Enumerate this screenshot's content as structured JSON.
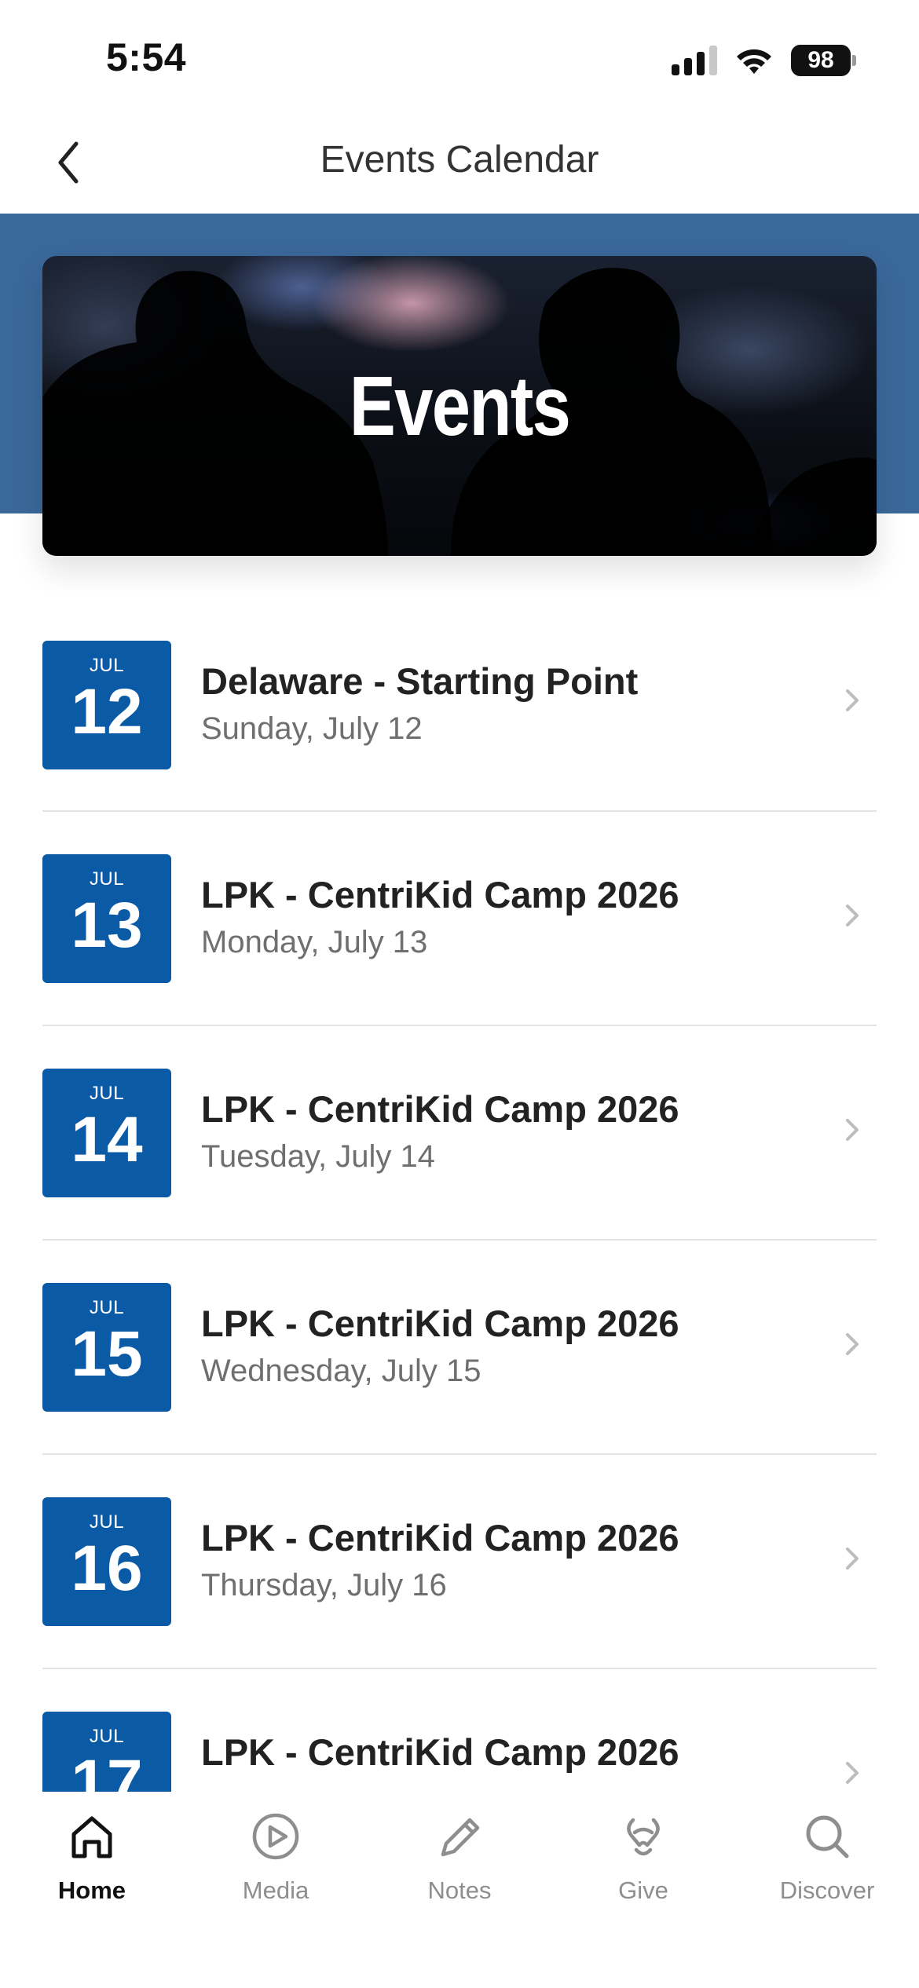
{
  "status_bar": {
    "time": "5:54",
    "battery": "98",
    "icons": [
      "cellular-signal-icon",
      "wifi-icon",
      "battery-icon"
    ]
  },
  "header": {
    "title": "Events Calendar",
    "back_icon": "chevron-left-icon"
  },
  "banner": {
    "title": "Events"
  },
  "events": [
    {
      "month": "JUL",
      "day": "12",
      "title": "Delaware - Starting Point",
      "date": "Sunday, July 12"
    },
    {
      "month": "JUL",
      "day": "13",
      "title": "LPK - CentriKid Camp 2026",
      "date": "Monday, July 13"
    },
    {
      "month": "JUL",
      "day": "14",
      "title": "LPK - CentriKid Camp 2026",
      "date": "Tuesday, July 14"
    },
    {
      "month": "JUL",
      "day": "15",
      "title": "LPK - CentriKid Camp 2026",
      "date": "Wednesday, July 15"
    },
    {
      "month": "JUL",
      "day": "16",
      "title": "LPK - CentriKid Camp 2026",
      "date": "Thursday, July 16"
    },
    {
      "month": "JUL",
      "day": "17",
      "title": "LPK - CentriKid Camp 2026",
      "date": ""
    }
  ],
  "tabs": [
    {
      "label": "Home",
      "icon": "home-icon",
      "active": true
    },
    {
      "label": "Media",
      "icon": "play-circle-icon",
      "active": false
    },
    {
      "label": "Notes",
      "icon": "pencil-icon",
      "active": false
    },
    {
      "label": "Give",
      "icon": "give-icon",
      "active": false
    },
    {
      "label": "Discover",
      "icon": "search-icon",
      "active": false
    }
  ],
  "colors": {
    "brand_blue": "#0a5aa6",
    "header_band": "#3a6899",
    "active_tab": "#111111",
    "inactive_tab": "#8e8e8e"
  }
}
